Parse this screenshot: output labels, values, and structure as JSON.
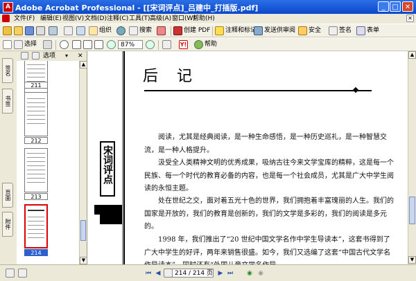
{
  "window": {
    "title": "Adobe Acrobat Professional - [[宋词评点]_吕建中_打插版.pdf]",
    "app_icon": "A"
  },
  "menu": [
    {
      "label": "文件(F)"
    },
    {
      "label": "编辑(E)"
    },
    {
      "label": "视图(V)"
    },
    {
      "label": "文档(D)"
    },
    {
      "label": "注释(C)"
    },
    {
      "label": "工具(T)"
    },
    {
      "label": "高级(A)"
    },
    {
      "label": "窗口(W)"
    },
    {
      "label": "帮助(H)"
    }
  ],
  "toolbar1": {
    "organize": "组织",
    "search": "搜索",
    "create_pdf": "创建 PDF",
    "comment_markup": "注释和标记",
    "send_review": "发送供审阅",
    "secure": "安全",
    "sign": "签名",
    "forms": "表单"
  },
  "toolbar2": {
    "select": "选择",
    "zoom_value": "87%",
    "help": "帮助"
  },
  "left_tabs": [
    "签名",
    "书签",
    "页面",
    "附件"
  ],
  "panel": {
    "options": "选项"
  },
  "thumbnails": [
    {
      "label": "211",
      "selected": false
    },
    {
      "label": "212",
      "selected": false
    },
    {
      "label": "213",
      "selected": false
    },
    {
      "label": "214",
      "selected": true
    }
  ],
  "spine_title": "宋词评点",
  "page": {
    "heading": "后 记",
    "paragraphs": [
      "阅读，尤其是经典阅读，是一种生命感悟，是一种历史巡礼，是一种智慧交流，是一种人格提升。",
      "汲受全人类精神文明的优秀成果，吸纳古往今来文学宝库的精粹，这是每一个民族、每一个时代的教育必备的内容，也是每一个社会成员，尤其是广大中学生阅读的永恒主题。",
      "处在世纪之交，面对着五光十色的世界，我们拥抱着丰富瑰丽的人生。我们的国家是开放的，我们的教育是创新的，我们的文学是多彩的，我们的阅读是多元的。",
      "1998 年，我们推出了“20 世纪中国文学名作中学生导读本”，这套书得到了广大中学生的好评，两年来销售很盛。如今，我们又选编了这套“中国古代文学名作导读本”，同时还有“外国儿童文学名作导"
    ]
  },
  "status": {
    "page_field": "214 / 214 页"
  }
}
